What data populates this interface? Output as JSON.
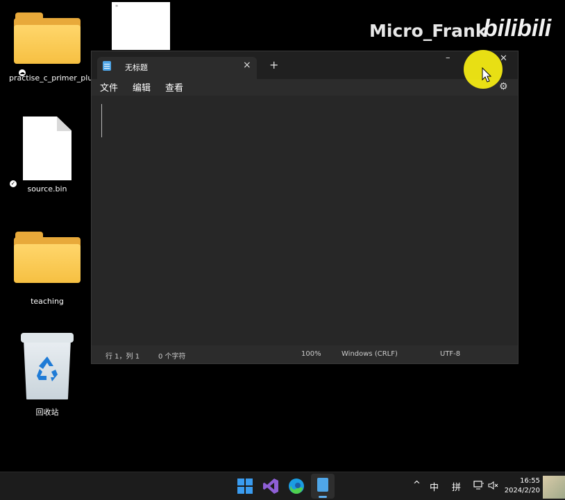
{
  "desktop": {
    "icons": [
      {
        "label": "practise_c_primer_plus"
      },
      {
        "label": "source.bin"
      },
      {
        "label": "teaching"
      },
      {
        "label": "回收站"
      }
    ]
  },
  "watermark": {
    "text": "Micro_Frank",
    "logo": "bilibili"
  },
  "notepad": {
    "tab_title": "无标题",
    "tab_close": "×",
    "new_tab": "+",
    "minimize": "–",
    "close": "✕",
    "menu": [
      "文件",
      "编辑",
      "查看"
    ],
    "settings_icon": "gear-icon",
    "status": {
      "position": "行 1，列 1",
      "chars": "0 个字符",
      "zoom": "100%",
      "line_ending": "Windows (CRLF)",
      "encoding": "UTF-8"
    }
  },
  "taskbar": {
    "tray": {
      "chevron": "^",
      "ime1": "中",
      "ime2": "拼"
    },
    "time": "16:55",
    "date": "2024/2/20"
  },
  "colors": {
    "folder": "#f6c042",
    "notepad_accent": "#4fa6e8",
    "highlight": "#f3ea14"
  }
}
